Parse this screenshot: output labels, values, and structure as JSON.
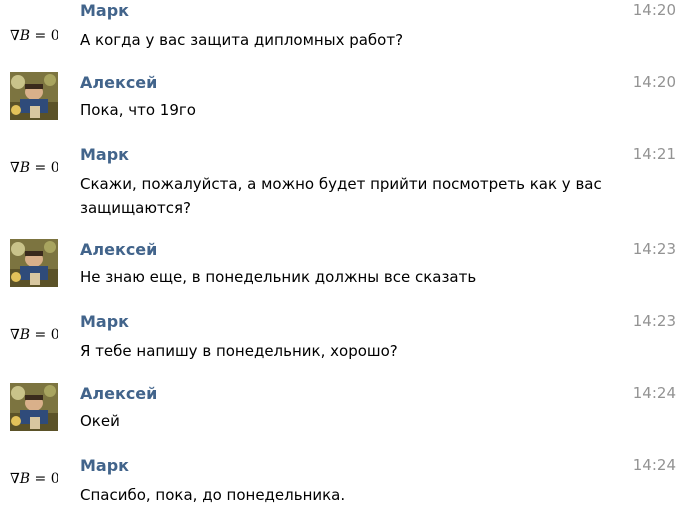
{
  "messages": [
    {
      "sender": "Марк",
      "avatar_type": "formula",
      "time": "14:20",
      "text": "А когда у вас защита дипломных работ?"
    },
    {
      "sender": "Алексей",
      "avatar_type": "photo",
      "time": "14:20",
      "text": "Пока, что 19го"
    },
    {
      "sender": "Марк",
      "avatar_type": "formula",
      "time": "14:21",
      "text": "Скажи, пожалуйста, а можно будет прийти посмотреть как у вас защищаются?"
    },
    {
      "sender": "Алексей",
      "avatar_type": "photo",
      "time": "14:23",
      "text": "Не знаю еще, в понедельник должны все сказать"
    },
    {
      "sender": "Марк",
      "avatar_type": "formula",
      "time": "14:23",
      "text": "Я тебе напишу в понедельник, хорошо?"
    },
    {
      "sender": "Алексей",
      "avatar_type": "photo",
      "time": "14:24",
      "text": "Окей"
    },
    {
      "sender": "Марк",
      "avatar_type": "formula",
      "time": "14:24",
      "text": "Спасибо, пока, до понедельника."
    }
  ],
  "avatar_formula": {
    "nabla": "∇",
    "var": "B",
    "rest": " = 0"
  },
  "colors": {
    "sender_name": "#42648b",
    "timestamp": "#939393",
    "message_text": "#000000",
    "background": "#ffffff"
  },
  "icons": {
    "photo_avatar": "user-photo-avatar",
    "formula_avatar": "formula-avatar"
  }
}
